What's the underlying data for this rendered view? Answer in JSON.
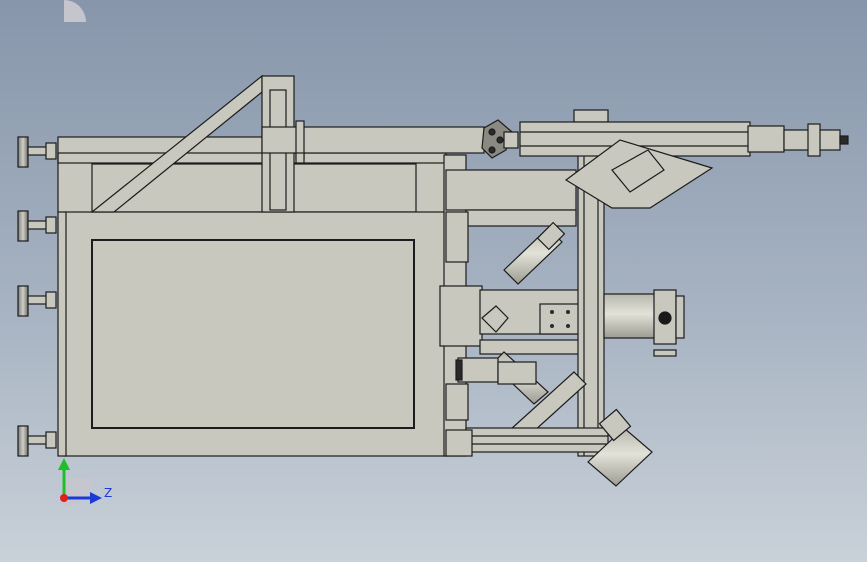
{
  "scene": {
    "view": "orthographic-side",
    "background_top": "#8796ab",
    "background_bottom": "#c9d1d9",
    "part_fill": "#c8c8be",
    "part_stroke": "#1c1c1c",
    "dark_part": "#2a2a2a"
  },
  "triad": {
    "z_label": "Z",
    "x_color": "#e0201a",
    "y_color": "#1fbf2a",
    "z_color": "#1a3ad8",
    "icons": [
      "x-axis-arrow-icon",
      "y-axis-arrow-icon",
      "z-axis-arrow-icon"
    ]
  }
}
